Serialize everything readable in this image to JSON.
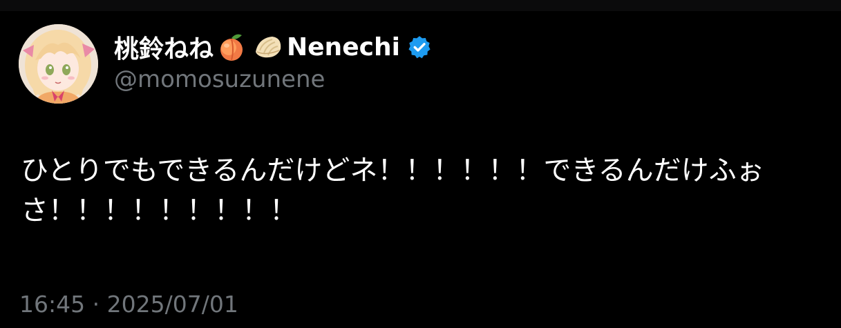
{
  "author": {
    "display_name": "桃鈴ねね",
    "emoji_1": "peach-emoji",
    "emoji_2": "dumpling-emoji",
    "nickname": "Nenechi",
    "verified": true,
    "handle": "@momosuzunene"
  },
  "tweet": {
    "line_1": "ひとりでもできるんだけどネ！！！！！！できるんだけふぉ",
    "line_2": "さ！！！！！！！！！"
  },
  "meta": {
    "time": "16:45",
    "separator": "·",
    "date": "2025/07/01"
  },
  "colors": {
    "background": "#000000",
    "text_primary": "#ffffff",
    "text_secondary": "#71767b",
    "verified_blue": "#1d9bf0"
  }
}
